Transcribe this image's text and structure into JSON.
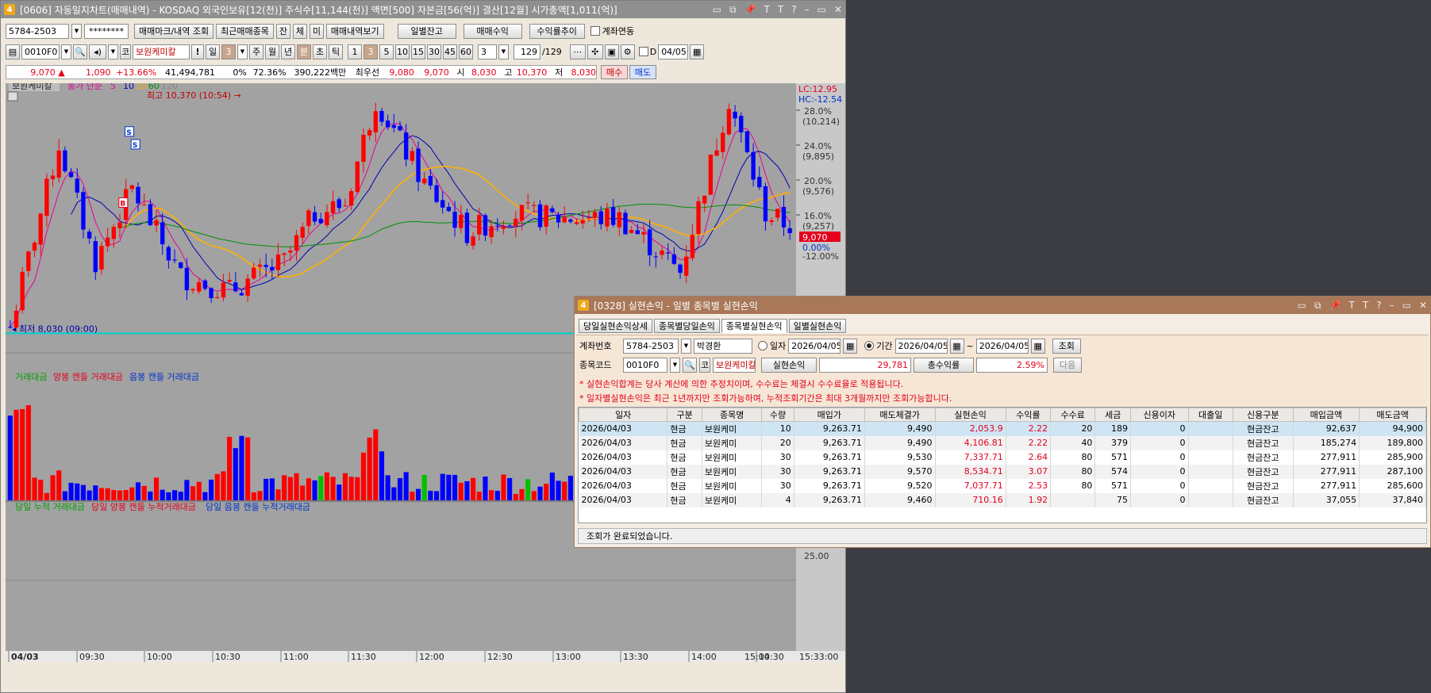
{
  "chart_win": {
    "title": "[0606] 자동일지차트(매매내역) - KOSDAQ 외국인보유[12(천)] 주식수[11,144(천)] 액면[500] 자본금[56(억)] 결산[12월] 시가총액[1,011(억)]",
    "num": "4",
    "tb_icons": [
      "▭",
      "⧉",
      "📌",
      "T",
      "T",
      "?",
      "–",
      "▭",
      "✕"
    ],
    "account": "5784-2503",
    "password": "********",
    "btns": [
      "매매마크/내역 조회",
      "최근매매종목",
      "잔",
      "체",
      "미",
      "매매내역보기",
      "일별잔고",
      "매매수익",
      "수익률추이"
    ],
    "link_label": "계좌연동",
    "code": "0010F0",
    "stock_name": "보원케미칼",
    "period_btns": [
      "일",
      "3",
      "주",
      "월",
      "년",
      "분",
      "초",
      "틱",
      "1",
      "3",
      "5",
      "10",
      "15",
      "30",
      "45",
      "60"
    ],
    "period_sel": "3",
    "count": "129",
    "count_total": "/129",
    "d_label": "D",
    "date": "04/05",
    "quote": {
      "price": "9,070 ▲",
      "change": "1,090",
      "rate": "+13.66%",
      "volume": "41,494,781",
      "pct0": "0%",
      "pct1": "72.36%",
      "amount": "390,222백만",
      "best_label": "최우선",
      "ask": "9,080",
      "bid": "9,070",
      "open_label": "시",
      "open": "8,030",
      "high_label": "고",
      "high": "10,370",
      "low_label": "저",
      "low": "8,030",
      "buy": "매수",
      "sell": "매도"
    },
    "legend": {
      "name": "보원케미칼",
      "ma_label": "종가 단순",
      "ma": [
        "5",
        "10",
        "20",
        "60",
        "120"
      ]
    },
    "high_mark": "최고 10,370 (10:54) →",
    "low_mark": "최저 8,030 (09:00)",
    "right_axis": {
      "lc": "LC:12.95",
      "hc": "HC:-12.54",
      "ticks": [
        {
          "pct": "28.0%",
          "price": "(10,214)"
        },
        {
          "pct": "24.0%",
          "price": "(9,895)"
        },
        {
          "pct": "20.0%",
          "price": "(9,576)"
        },
        {
          "pct": "16.0%",
          "price": "(9,257)"
        }
      ],
      "cur_price": "9,070",
      "zero": "0.00%",
      "partial": "-12.00%",
      "vol_tick": "25.00"
    },
    "vol_legend": [
      "거래대금",
      "양봉 캔들 거래대금",
      "음봉 캔들 거래대금"
    ],
    "cum_legend": [
      "당일 누적 거래대금",
      "당일 양봉 캔들 누적거래대금",
      "당일 음봉 캔들 누적거래대금"
    ],
    "xaxis": [
      "04/03",
      "09:30",
      "10:00",
      "10:30",
      "11:00",
      "11:30",
      "12:00",
      "12:30",
      "13:00",
      "13:30",
      "14:00",
      "14:30",
      "15:00"
    ],
    "xaxis_end": "15:33:00",
    "colors": {
      "up": "#ff0000",
      "down": "#0000ff",
      "ma5": "#e8009a",
      "ma10": "#0000b0",
      "ma20": "#ffb000",
      "ma60": "#009000",
      "ma120": "#888888",
      "bg": "#a2a2a2"
    }
  },
  "pl_win": {
    "title": "[0328] 실현손익 - 일별 종목별 실현손익",
    "num": "4",
    "tabs": [
      "당일실현손익상세",
      "종목별당일손익",
      "종목별실현손익",
      "일별실현손익"
    ],
    "active_tab": 2,
    "acct_label": "계좌번호",
    "acct": "5784-2503",
    "owner": "박경환",
    "radio_day": "일자",
    "day_date": "2026/04/05",
    "radio_period": "기간",
    "from_date": "2026/04/05",
    "tilde": "~",
    "to_date": "2026/04/05",
    "query": "조회",
    "code_label": "종목코드",
    "code": "0010F0",
    "stock_name": "보원케미칼",
    "realized_label": "실현손익",
    "realized": "29,781",
    "total_rate_label": "총수익률",
    "total_rate": "2.59%",
    "next": "다음",
    "notes": [
      "* 실현손익합계는 당사 계산에 의한 추정치이며, 수수료는 체결시 수수료율로 적용됩니다.",
      "* 일자별실현손익은 최근 1년까지만 조회가능하며, 누적조회기간은 최대 3개월까지만 조회가능합니다."
    ],
    "columns": [
      "일자",
      "구분",
      "종목명",
      "수량",
      "매입가",
      "매도체결가",
      "실현손익",
      "수익률",
      "수수료",
      "세금",
      "신용이자",
      "대출일",
      "신용구분",
      "매입금액",
      "매도금액"
    ],
    "rows": [
      [
        "2026/04/03",
        "현금",
        "보원케미",
        "10",
        "9,263.71",
        "9,490",
        "2,053.9",
        "2.22",
        "20",
        "189",
        "0",
        "",
        "현금잔고",
        "92,637",
        "94,900"
      ],
      [
        "2026/04/03",
        "현금",
        "보원케미",
        "20",
        "9,263.71",
        "9,490",
        "4,106.81",
        "2.22",
        "40",
        "379",
        "0",
        "",
        "현금잔고",
        "185,274",
        "189,800"
      ],
      [
        "2026/04/03",
        "현금",
        "보원케미",
        "30",
        "9,263.71",
        "9,530",
        "7,337.71",
        "2.64",
        "80",
        "571",
        "0",
        "",
        "현금잔고",
        "277,911",
        "285,900"
      ],
      [
        "2026/04/03",
        "현금",
        "보원케미",
        "30",
        "9,263.71",
        "9,570",
        "8,534.71",
        "3.07",
        "80",
        "574",
        "0",
        "",
        "현금잔고",
        "277,911",
        "287,100"
      ],
      [
        "2026/04/03",
        "현금",
        "보원케미",
        "30",
        "9,263.71",
        "9,520",
        "7,037.71",
        "2.53",
        "80",
        "571",
        "0",
        "",
        "현금잔고",
        "277,911",
        "285,600"
      ],
      [
        "2026/04/03",
        "현금",
        "보원케미",
        "4",
        "9,263.71",
        "9,460",
        "710.16",
        "1.92",
        "",
        "75",
        "0",
        "",
        "현금잔고",
        "37,055",
        "37,840"
      ]
    ],
    "status": "조회가 완료되었습니다."
  },
  "chart_data": {
    "type": "candlestick",
    "title": "보원케미칼",
    "x_range": [
      "09:00",
      "15:30"
    ],
    "ylim": [
      8030,
      10370
    ],
    "open": 8030,
    "high": 10370,
    "low": 8030,
    "last": 9070,
    "moving_averages": [
      "5",
      "10",
      "20",
      "60",
      "120"
    ],
    "trade_marks": [
      {
        "type": "B",
        "time": "09:51"
      },
      {
        "type": "S",
        "time": "09:57"
      },
      {
        "type": "S",
        "time": "09:57"
      }
    ],
    "volume_scale_tick": 25.0
  }
}
